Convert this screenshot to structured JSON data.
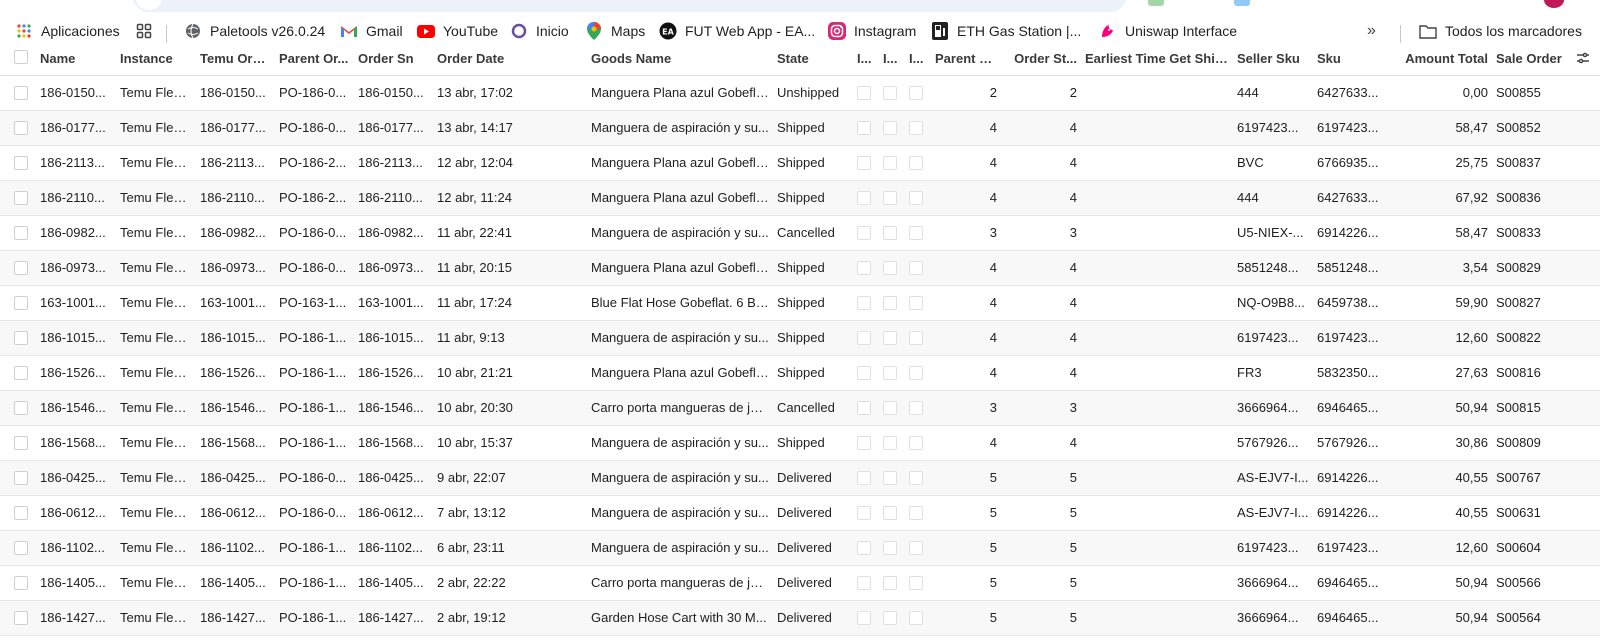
{
  "bookmarks": [
    {
      "label": "Aplicaciones",
      "icon": "apps-grid-icon"
    },
    {
      "label": "",
      "icon": "tab-groups-icon"
    },
    {
      "label": "Paletools v26.0.24",
      "icon": "globe-icon"
    },
    {
      "label": "Gmail",
      "icon": "gmail-icon"
    },
    {
      "label": "YouTube",
      "icon": "youtube-icon"
    },
    {
      "label": "Inicio",
      "icon": "circle-icon"
    },
    {
      "label": "Maps",
      "icon": "maps-pin-icon"
    },
    {
      "label": "FUT Web App - EA...",
      "icon": "ea-icon"
    },
    {
      "label": "Instagram",
      "icon": "instagram-icon"
    },
    {
      "label": "ETH Gas Station |...",
      "icon": "gas-station-icon"
    },
    {
      "label": "Uniswap Interface",
      "icon": "uniswap-icon"
    }
  ],
  "more_bookmarks_label": "»",
  "all_bookmarks_label": "Todos los marcadores",
  "columns": {
    "name": "Name",
    "instance": "Instance",
    "temu_order": "Temu Order",
    "parent_order": "Parent Or...",
    "order_sn": "Order Sn",
    "order_date": "Order Date",
    "goods_name": "Goods Name",
    "state": "State",
    "c1": "I...",
    "c2": "I...",
    "c3": "I...",
    "parent_o": "Parent O...",
    "order_st": "Order St...",
    "earliest": "Earliest Time Get Ship...",
    "seller_sku": "Seller Sku",
    "sku": "Sku",
    "amount": "Amount Total",
    "sale_order": "Sale Order"
  },
  "rows": [
    {
      "name": "186-0150...",
      "instance": "Temu Flexi...",
      "temu_order": "186-0150...",
      "parent_order": "PO-186-0...",
      "order_sn": "186-0150...",
      "order_date": "13 abr, 17:02",
      "goods_name": "Manguera Plana azul Gobefla...",
      "state": "Unshipped",
      "parent_o": "2",
      "order_st": "2",
      "earliest": "",
      "seller_sku": "444",
      "sku": "6427633...",
      "amount": "0,00",
      "sale_order": "S00855"
    },
    {
      "name": "186-0177...",
      "instance": "Temu Flexi...",
      "temu_order": "186-0177...",
      "parent_order": "PO-186-0...",
      "order_sn": "186-0177...",
      "order_date": "13 abr, 14:17",
      "goods_name": "Manguera de aspiración y su...",
      "state": "Shipped",
      "parent_o": "4",
      "order_st": "4",
      "earliest": "",
      "seller_sku": "6197423...",
      "sku": "6197423...",
      "amount": "58,47",
      "sale_order": "S00852"
    },
    {
      "name": "186-2113...",
      "instance": "Temu Flexi...",
      "temu_order": "186-2113...",
      "parent_order": "PO-186-2...",
      "order_sn": "186-2113...",
      "order_date": "12 abr, 12:04",
      "goods_name": "Manguera Plana azul Gobefla...",
      "state": "Shipped",
      "parent_o": "4",
      "order_st": "4",
      "earliest": "",
      "seller_sku": "BVC",
      "sku": "6766935...",
      "amount": "25,75",
      "sale_order": "S00837"
    },
    {
      "name": "186-2110...",
      "instance": "Temu Flexi...",
      "temu_order": "186-2110...",
      "parent_order": "PO-186-2...",
      "order_sn": "186-2110...",
      "order_date": "12 abr, 11:24",
      "goods_name": "Manguera Plana azul Gobefla...",
      "state": "Shipped",
      "parent_o": "4",
      "order_st": "4",
      "earliest": "",
      "seller_sku": "444",
      "sku": "6427633...",
      "amount": "67,92",
      "sale_order": "S00836"
    },
    {
      "name": "186-0982...",
      "instance": "Temu Flexi...",
      "temu_order": "186-0982...",
      "parent_order": "PO-186-0...",
      "order_sn": "186-0982...",
      "order_date": "11 abr, 22:41",
      "goods_name": "Manguera de aspiración y su...",
      "state": "Cancelled",
      "parent_o": "3",
      "order_st": "3",
      "earliest": "",
      "seller_sku": "U5-NIEX-...",
      "sku": "6914226...",
      "amount": "58,47",
      "sale_order": "S00833"
    },
    {
      "name": "186-0973...",
      "instance": "Temu Flexi...",
      "temu_order": "186-0973...",
      "parent_order": "PO-186-0...",
      "order_sn": "186-0973...",
      "order_date": "11 abr, 20:15",
      "goods_name": "Manguera Plana azul Gobefla...",
      "state": "Shipped",
      "parent_o": "4",
      "order_st": "4",
      "earliest": "",
      "seller_sku": "5851248...",
      "sku": "5851248...",
      "amount": "3,54",
      "sale_order": "S00829"
    },
    {
      "name": "163-1001...",
      "instance": "Temu Flexi...",
      "temu_order": "163-1001...",
      "parent_order": "PO-163-1...",
      "order_sn": "163-1001...",
      "order_date": "11 abr, 17:24",
      "goods_name": "Blue Flat Hose Gobeflat. 6 Ba...",
      "state": "Shipped",
      "parent_o": "4",
      "order_st": "4",
      "earliest": "",
      "seller_sku": "NQ-O9B8...",
      "sku": "6459738...",
      "amount": "59,90",
      "sale_order": "S00827"
    },
    {
      "name": "186-1015...",
      "instance": "Temu Flexi...",
      "temu_order": "186-1015...",
      "parent_order": "PO-186-1...",
      "order_sn": "186-1015...",
      "order_date": "11 abr, 9:13",
      "goods_name": "Manguera de aspiración y su...",
      "state": "Shipped",
      "parent_o": "4",
      "order_st": "4",
      "earliest": "",
      "seller_sku": "6197423...",
      "sku": "6197423...",
      "amount": "12,60",
      "sale_order": "S00822"
    },
    {
      "name": "186-1526...",
      "instance": "Temu Flexi...",
      "temu_order": "186-1526...",
      "parent_order": "PO-186-1...",
      "order_sn": "186-1526...",
      "order_date": "10 abr, 21:21",
      "goods_name": "Manguera Plana azul Gobefla...",
      "state": "Shipped",
      "parent_o": "4",
      "order_st": "4",
      "earliest": "",
      "seller_sku": "FR3",
      "sku": "5832350...",
      "amount": "27,63",
      "sale_order": "S00816"
    },
    {
      "name": "186-1546...",
      "instance": "Temu Flexi...",
      "temu_order": "186-1546...",
      "parent_order": "PO-186-1...",
      "order_sn": "186-1546...",
      "order_date": "10 abr, 20:30",
      "goods_name": "Carro porta mangueras de jar...",
      "state": "Cancelled",
      "parent_o": "3",
      "order_st": "3",
      "earliest": "",
      "seller_sku": "3666964...",
      "sku": "6946465...",
      "amount": "50,94",
      "sale_order": "S00815"
    },
    {
      "name": "186-1568...",
      "instance": "Temu Flexi...",
      "temu_order": "186-1568...",
      "parent_order": "PO-186-1...",
      "order_sn": "186-1568...",
      "order_date": "10 abr, 15:37",
      "goods_name": "Manguera de aspiración y su...",
      "state": "Shipped",
      "parent_o": "4",
      "order_st": "4",
      "earliest": "",
      "seller_sku": "5767926...",
      "sku": "5767926...",
      "amount": "30,86",
      "sale_order": "S00809"
    },
    {
      "name": "186-0425...",
      "instance": "Temu Flexi...",
      "temu_order": "186-0425...",
      "parent_order": "PO-186-0...",
      "order_sn": "186-0425...",
      "order_date": "9 abr, 22:07",
      "goods_name": "Manguera de aspiración y su...",
      "state": "Delivered",
      "parent_o": "5",
      "order_st": "5",
      "earliest": "",
      "seller_sku": "AS-EJV7-I...",
      "sku": "6914226...",
      "amount": "40,55",
      "sale_order": "S00767"
    },
    {
      "name": "186-0612...",
      "instance": "Temu Flexi...",
      "temu_order": "186-0612...",
      "parent_order": "PO-186-0...",
      "order_sn": "186-0612...",
      "order_date": "7 abr, 13:12",
      "goods_name": "Manguera de aspiración y su...",
      "state": "Delivered",
      "parent_o": "5",
      "order_st": "5",
      "earliest": "",
      "seller_sku": "AS-EJV7-I...",
      "sku": "6914226...",
      "amount": "40,55",
      "sale_order": "S00631"
    },
    {
      "name": "186-1102...",
      "instance": "Temu Flexi...",
      "temu_order": "186-1102...",
      "parent_order": "PO-186-1...",
      "order_sn": "186-1102...",
      "order_date": "6 abr, 23:11",
      "goods_name": "Manguera de aspiración y su...",
      "state": "Delivered",
      "parent_o": "5",
      "order_st": "5",
      "earliest": "",
      "seller_sku": "6197423...",
      "sku": "6197423...",
      "amount": "12,60",
      "sale_order": "S00604"
    },
    {
      "name": "186-1405...",
      "instance": "Temu Flexi...",
      "temu_order": "186-1405...",
      "parent_order": "PO-186-1...",
      "order_sn": "186-1405...",
      "order_date": "2 abr, 22:22",
      "goods_name": "Carro porta mangueras de jar...",
      "state": "Delivered",
      "parent_o": "5",
      "order_st": "5",
      "earliest": "",
      "seller_sku": "3666964...",
      "sku": "6946465...",
      "amount": "50,94",
      "sale_order": "S00566"
    },
    {
      "name": "186-1427...",
      "instance": "Temu Flexi...",
      "temu_order": "186-1427...",
      "parent_order": "PO-186-1...",
      "order_sn": "186-1427...",
      "order_date": "2 abr, 19:12",
      "goods_name": "Garden Hose Cart with 30 M...",
      "state": "Delivered",
      "parent_o": "5",
      "order_st": "5",
      "earliest": "",
      "seller_sku": "3666964...",
      "sku": "6946465...",
      "amount": "50,94",
      "sale_order": "S00564"
    }
  ]
}
